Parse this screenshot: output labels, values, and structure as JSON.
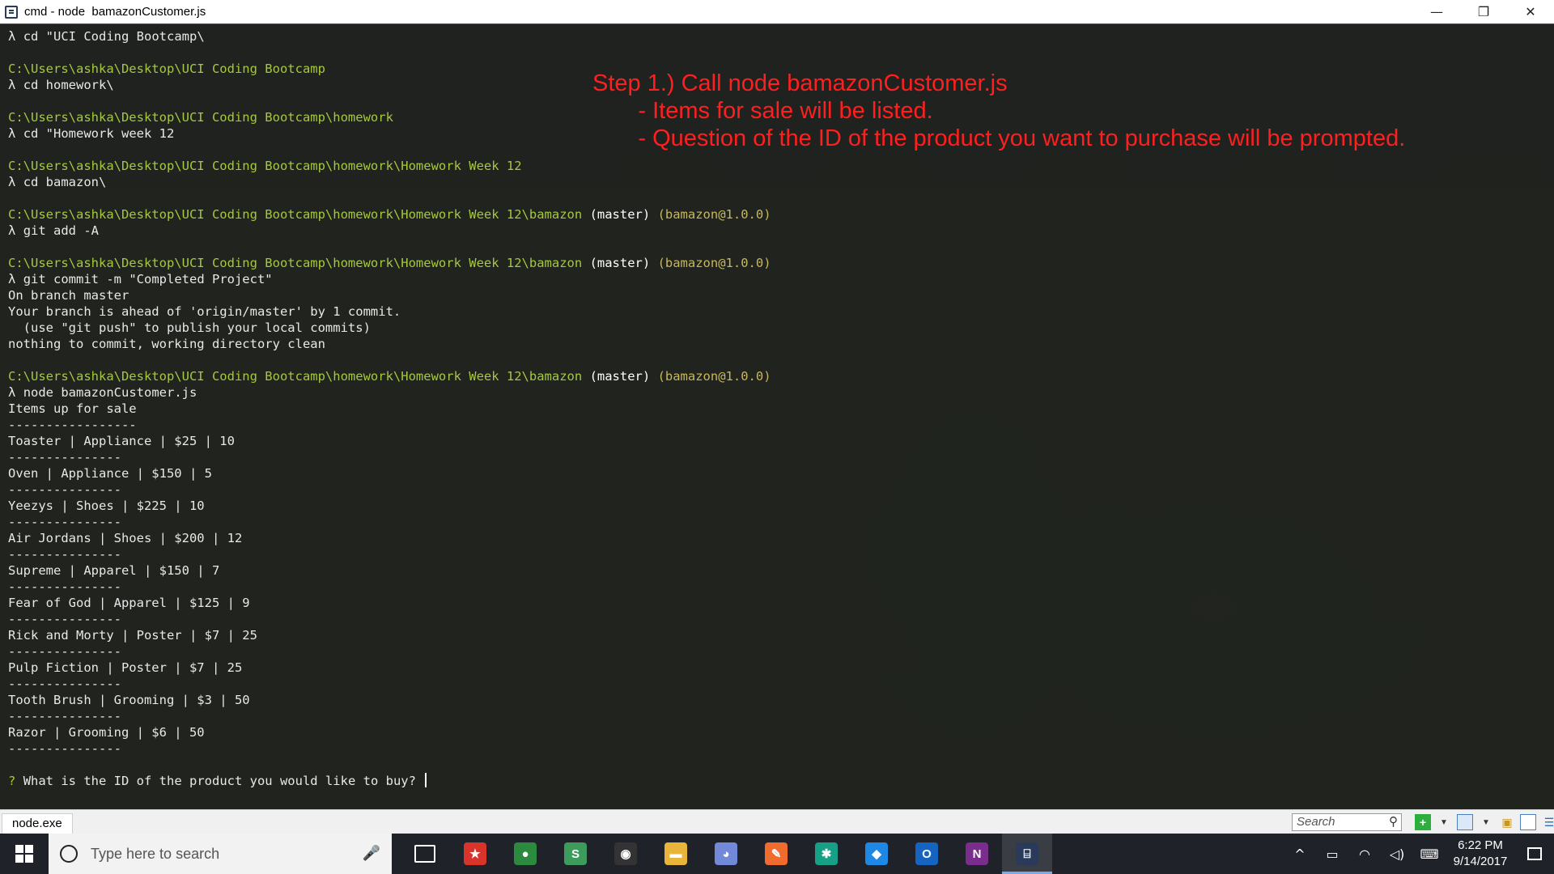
{
  "window": {
    "title": "cmd - node  bamazonCustomer.js",
    "controls": [
      "—",
      "❐",
      "✕"
    ]
  },
  "console": {
    "prompt_symbol": "λ",
    "lines": [
      {
        "type": "cmd",
        "text": "cd \"UCI Coding Bootcamp\\"
      },
      {
        "type": "blank"
      },
      {
        "type": "path",
        "text": "C:\\Users\\ashka\\Desktop\\UCI Coding Bootcamp"
      },
      {
        "type": "cmd",
        "text": "cd homework\\"
      },
      {
        "type": "blank"
      },
      {
        "type": "path",
        "text": "C:\\Users\\ashka\\Desktop\\UCI Coding Bootcamp\\homework"
      },
      {
        "type": "cmd",
        "text": "cd \"Homework week 12"
      },
      {
        "type": "blank"
      },
      {
        "type": "path",
        "text": "C:\\Users\\ashka\\Desktop\\UCI Coding Bootcamp\\homework\\Homework Week 12"
      },
      {
        "type": "cmd",
        "text": "cd bamazon\\"
      },
      {
        "type": "blank"
      },
      {
        "type": "path",
        "text": "C:\\Users\\ashka\\Desktop\\UCI Coding Bootcamp\\homework\\Homework Week 12\\bamazon",
        "branch": "(master)",
        "pkg": "(bamazon@1.0.0)"
      },
      {
        "type": "cmd",
        "text": "git add -A"
      },
      {
        "type": "blank"
      },
      {
        "type": "path",
        "text": "C:\\Users\\ashka\\Desktop\\UCI Coding Bootcamp\\homework\\Homework Week 12\\bamazon",
        "branch": "(master)",
        "pkg": "(bamazon@1.0.0)"
      },
      {
        "type": "cmd",
        "text": "git commit -m \"Completed Project\""
      },
      {
        "type": "out",
        "text": "On branch master"
      },
      {
        "type": "out",
        "text": "Your branch is ahead of 'origin/master' by 1 commit."
      },
      {
        "type": "out",
        "text": "  (use \"git push\" to publish your local commits)"
      },
      {
        "type": "out",
        "text": "nothing to commit, working directory clean"
      },
      {
        "type": "blank"
      },
      {
        "type": "path",
        "text": "C:\\Users\\ashka\\Desktop\\UCI Coding Bootcamp\\homework\\Homework Week 12\\bamazon",
        "branch": "(master)",
        "pkg": "(bamazon@1.0.0)"
      },
      {
        "type": "cmd",
        "text": "node bamazonCustomer.js"
      },
      {
        "type": "out",
        "text": "Items up for sale"
      },
      {
        "type": "out",
        "text": "-----------------"
      },
      {
        "type": "out",
        "text": "Toaster | Appliance | $25 | 10"
      },
      {
        "type": "out",
        "text": "---------------"
      },
      {
        "type": "out",
        "text": "Oven | Appliance | $150 | 5"
      },
      {
        "type": "out",
        "text": "---------------"
      },
      {
        "type": "out",
        "text": "Yeezys | Shoes | $225 | 10"
      },
      {
        "type": "out",
        "text": "---------------"
      },
      {
        "type": "out",
        "text": "Air Jordans | Shoes | $200 | 12"
      },
      {
        "type": "out",
        "text": "---------------"
      },
      {
        "type": "out",
        "text": "Supreme | Apparel | $150 | 7"
      },
      {
        "type": "out",
        "text": "---------------"
      },
      {
        "type": "out",
        "text": "Fear of God | Apparel | $125 | 9"
      },
      {
        "type": "out",
        "text": "---------------"
      },
      {
        "type": "out",
        "text": "Rick and Morty | Poster | $7 | 25"
      },
      {
        "type": "out",
        "text": "---------------"
      },
      {
        "type": "out",
        "text": "Pulp Fiction | Poster | $7 | 25"
      },
      {
        "type": "out",
        "text": "---------------"
      },
      {
        "type": "out",
        "text": "Tooth Brush | Grooming | $3 | 50"
      },
      {
        "type": "out",
        "text": "---------------"
      },
      {
        "type": "out",
        "text": "Razor | Grooming | $6 | 50"
      },
      {
        "type": "out",
        "text": "---------------"
      },
      {
        "type": "blank"
      },
      {
        "type": "question",
        "mark": "?",
        "text": "What is the ID of the product you would like to buy?"
      }
    ]
  },
  "annotation": {
    "color": "#ff1f1f",
    "lines": [
      "Step 1.) Call node bamazonCustomer.js",
      "       - Items for sale will be listed.",
      "       - Question of the ID of the product you want to purchase will be prompted."
    ]
  },
  "statusbar": {
    "tab_label": "node.exe",
    "search_placeholder": "Search"
  },
  "taskbar": {
    "search_placeholder": "Type here to search",
    "apps": [
      {
        "name": "task-view",
        "glyph": "▭",
        "color": "transparent"
      },
      {
        "name": "wunderlist",
        "glyph": "★",
        "color": "#d9342b"
      },
      {
        "name": "chrome",
        "glyph": "●",
        "color": "#2b8a3e"
      },
      {
        "name": "slack",
        "glyph": "S",
        "color": "#3d9b5c"
      },
      {
        "name": "color-app",
        "glyph": "◉",
        "color": "#333333"
      },
      {
        "name": "file-explorer",
        "glyph": "▬",
        "color": "#e8b43a"
      },
      {
        "name": "discord",
        "glyph": "◕",
        "color": "#7289da"
      },
      {
        "name": "pen-app",
        "glyph": "✎",
        "color": "#f06b2e"
      },
      {
        "name": "gitkraken",
        "glyph": "✱",
        "color": "#16a085"
      },
      {
        "name": "dropbox",
        "glyph": "◆",
        "color": "#1e88e5"
      },
      {
        "name": "outlook",
        "glyph": "O",
        "color": "#1565c0"
      },
      {
        "name": "onenote",
        "glyph": "N",
        "color": "#7b2d8e"
      },
      {
        "name": "cmder",
        "glyph": "⌸",
        "color": "#2a3a5a"
      }
    ],
    "active_app": "cmder",
    "time": "6:22 PM",
    "date": "9/14/2017"
  }
}
